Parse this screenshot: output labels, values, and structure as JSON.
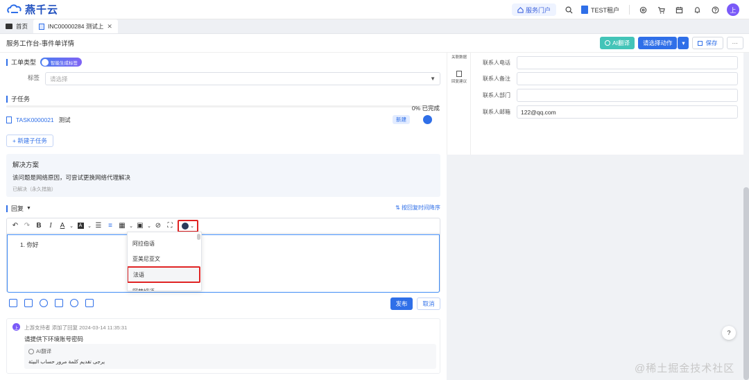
{
  "app": {
    "logo_text": "燕千云"
  },
  "topbar": {
    "portal_label": "服务门户",
    "tenant_label": "TEST租户",
    "avatar_text": "上",
    "icons": [
      "search-icon",
      "settings-icon",
      "cart-icon",
      "calendar-icon",
      "bell-icon",
      "help-icon"
    ]
  },
  "tabs": [
    {
      "label": "首页"
    },
    {
      "label": "INC00000284 测试上"
    }
  ],
  "page": {
    "title": "服务工作台-事件单详情",
    "actions": {
      "ai_translate": "AI翻译",
      "select_action": "请选择动作",
      "save": "保存",
      "more": "···"
    }
  },
  "ticket_type": {
    "heading": "工单类型",
    "ai_tag": "智能生成标签",
    "label_field": "标签",
    "label_placeholder": "请选择"
  },
  "subtasks": {
    "heading": "子任务",
    "progress_text": "0%  已完成",
    "progress": 0,
    "items": [
      {
        "code": "TASK0000021",
        "name": "测试",
        "status": "新建"
      }
    ],
    "new_button": "+ 新建子任务"
  },
  "solution": {
    "title": "解决方案",
    "text": "该问题是网络原因，可尝试更换网络代理解决",
    "meta": "已解决（永久措施）"
  },
  "reply": {
    "heading": "回复",
    "sort_label": "按回复时间降序",
    "editor_text": "1. 你好",
    "language_options": [
      "阿拉伯语",
      "亚美尼亚文",
      "法语",
      "阿萨姆语"
    ],
    "selected_language": "法语",
    "publish": "发布",
    "cancel": "取消"
  },
  "comment": {
    "avatar_text": "上",
    "meta": "上游支持者  添加了回复    2024-03-14 11:35:31",
    "text": "请提供下环境账号密码",
    "ai_label": "AI翻译",
    "ai_text": "يرجى تقديم كلمة مرور حساب البيئة"
  },
  "side_tabs": [
    {
      "label": "关联数据"
    },
    {
      "label": "回复建议"
    }
  ],
  "contact": [
    {
      "label": "联系人电话",
      "value": ""
    },
    {
      "label": "联系人备注",
      "value": ""
    },
    {
      "label": "联系人部门",
      "value": ""
    },
    {
      "label": "联系人邮箱",
      "value": "122@qq.com"
    }
  ],
  "help_text": "?",
  "watermark": "@稀土掘金技术社区",
  "colors": {
    "primary": "#2f6fe8",
    "ai": "#43c4b8",
    "highlight": "#e02424",
    "avatar": "#7a5af8"
  }
}
